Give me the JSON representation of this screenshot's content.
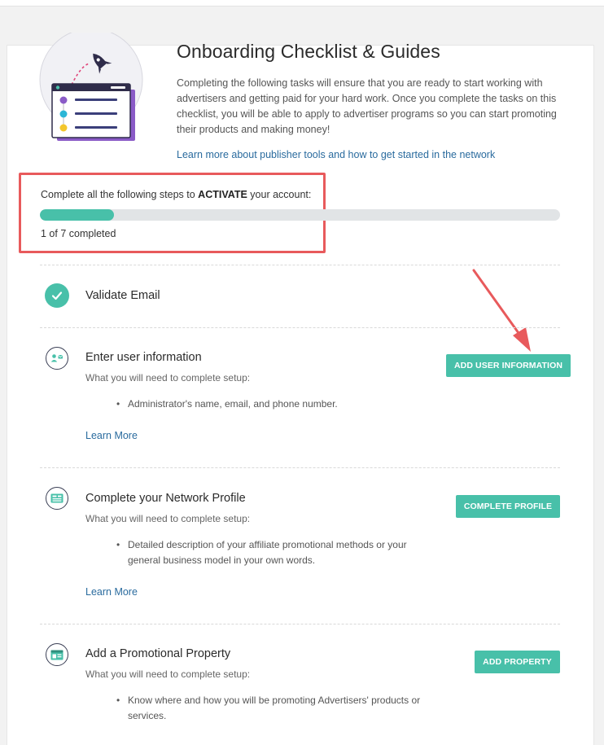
{
  "header": {
    "title": "Onboarding Checklist & Guides",
    "intro": "Completing the following tasks will ensure that you are ready to start working with advertisers and getting paid for your hard work. Once you complete the tasks on this checklist, you will be able to apply to advertiser programs so you can start promoting their products and making money!",
    "learn_link": "Learn more about publisher tools and how to get started in the network"
  },
  "progress": {
    "prefix": "Complete all the following steps to ",
    "emphasis": "ACTIVATE",
    "suffix": " your account:",
    "completed": 1,
    "total": 7,
    "count_text": "1 of 7 completed",
    "fill_fraction": 0.143
  },
  "steps": [
    {
      "title": "Validate Email",
      "status": "completed",
      "icon": "checkmark-icon"
    },
    {
      "title": "Enter user information",
      "subtitle": "What you will need to complete setup:",
      "bullet": "Administrator's name, email, and phone number.",
      "learn_more": "Learn More",
      "button": "ADD USER INFORMATION",
      "icon": "user-card-icon"
    },
    {
      "title": "Complete your Network Profile",
      "subtitle": "What you will need to complete setup:",
      "bullet": "Detailed description of your affiliate promotional methods or your general business model in your own words.",
      "learn_more": "Learn More",
      "button": "COMPLETE PROFILE",
      "icon": "profile-card-icon"
    },
    {
      "title": "Add a Promotional Property",
      "subtitle": "What you will need to complete setup:",
      "bullet": "Know where and how you will be promoting Advertisers' products or services.",
      "button": "ADD PROPERTY",
      "icon": "browser-window-icon"
    }
  ],
  "colors": {
    "accent": "#48c0a9",
    "link": "#2a6b9e",
    "annotation": "#e85a5c",
    "track": "#e1e4e6"
  }
}
